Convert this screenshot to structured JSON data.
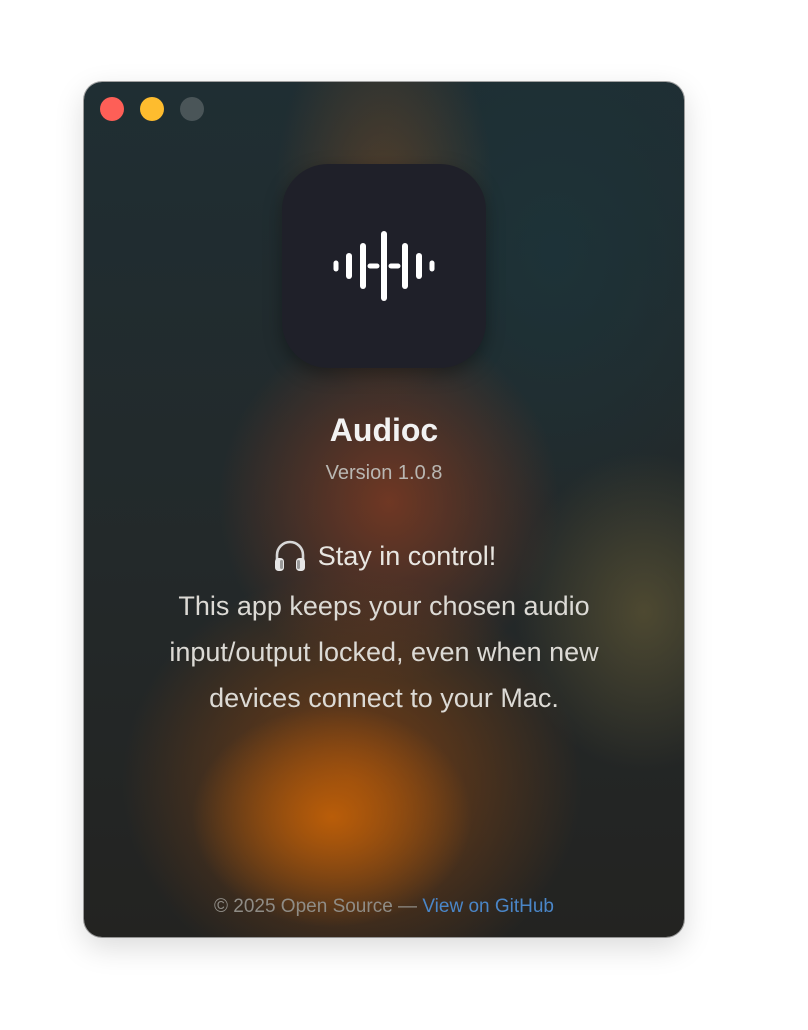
{
  "window": {
    "controls": {
      "close_color": "#fe5f57",
      "minimize_color": "#febc2e",
      "zoom_color": "#4a5558"
    }
  },
  "app": {
    "icon": "waveform-icon",
    "name": "Audioc",
    "version": "Version 1.0.8"
  },
  "tagline": {
    "icon": "headphones-icon",
    "text": "Stay in control!"
  },
  "description": "This app keeps your chosen audio input/output locked, even when new devices connect to your Mac.",
  "footer": {
    "copyright": "© 2025 Open Source — ",
    "link_label": "View on GitHub",
    "link_color": "#4a86c8"
  }
}
